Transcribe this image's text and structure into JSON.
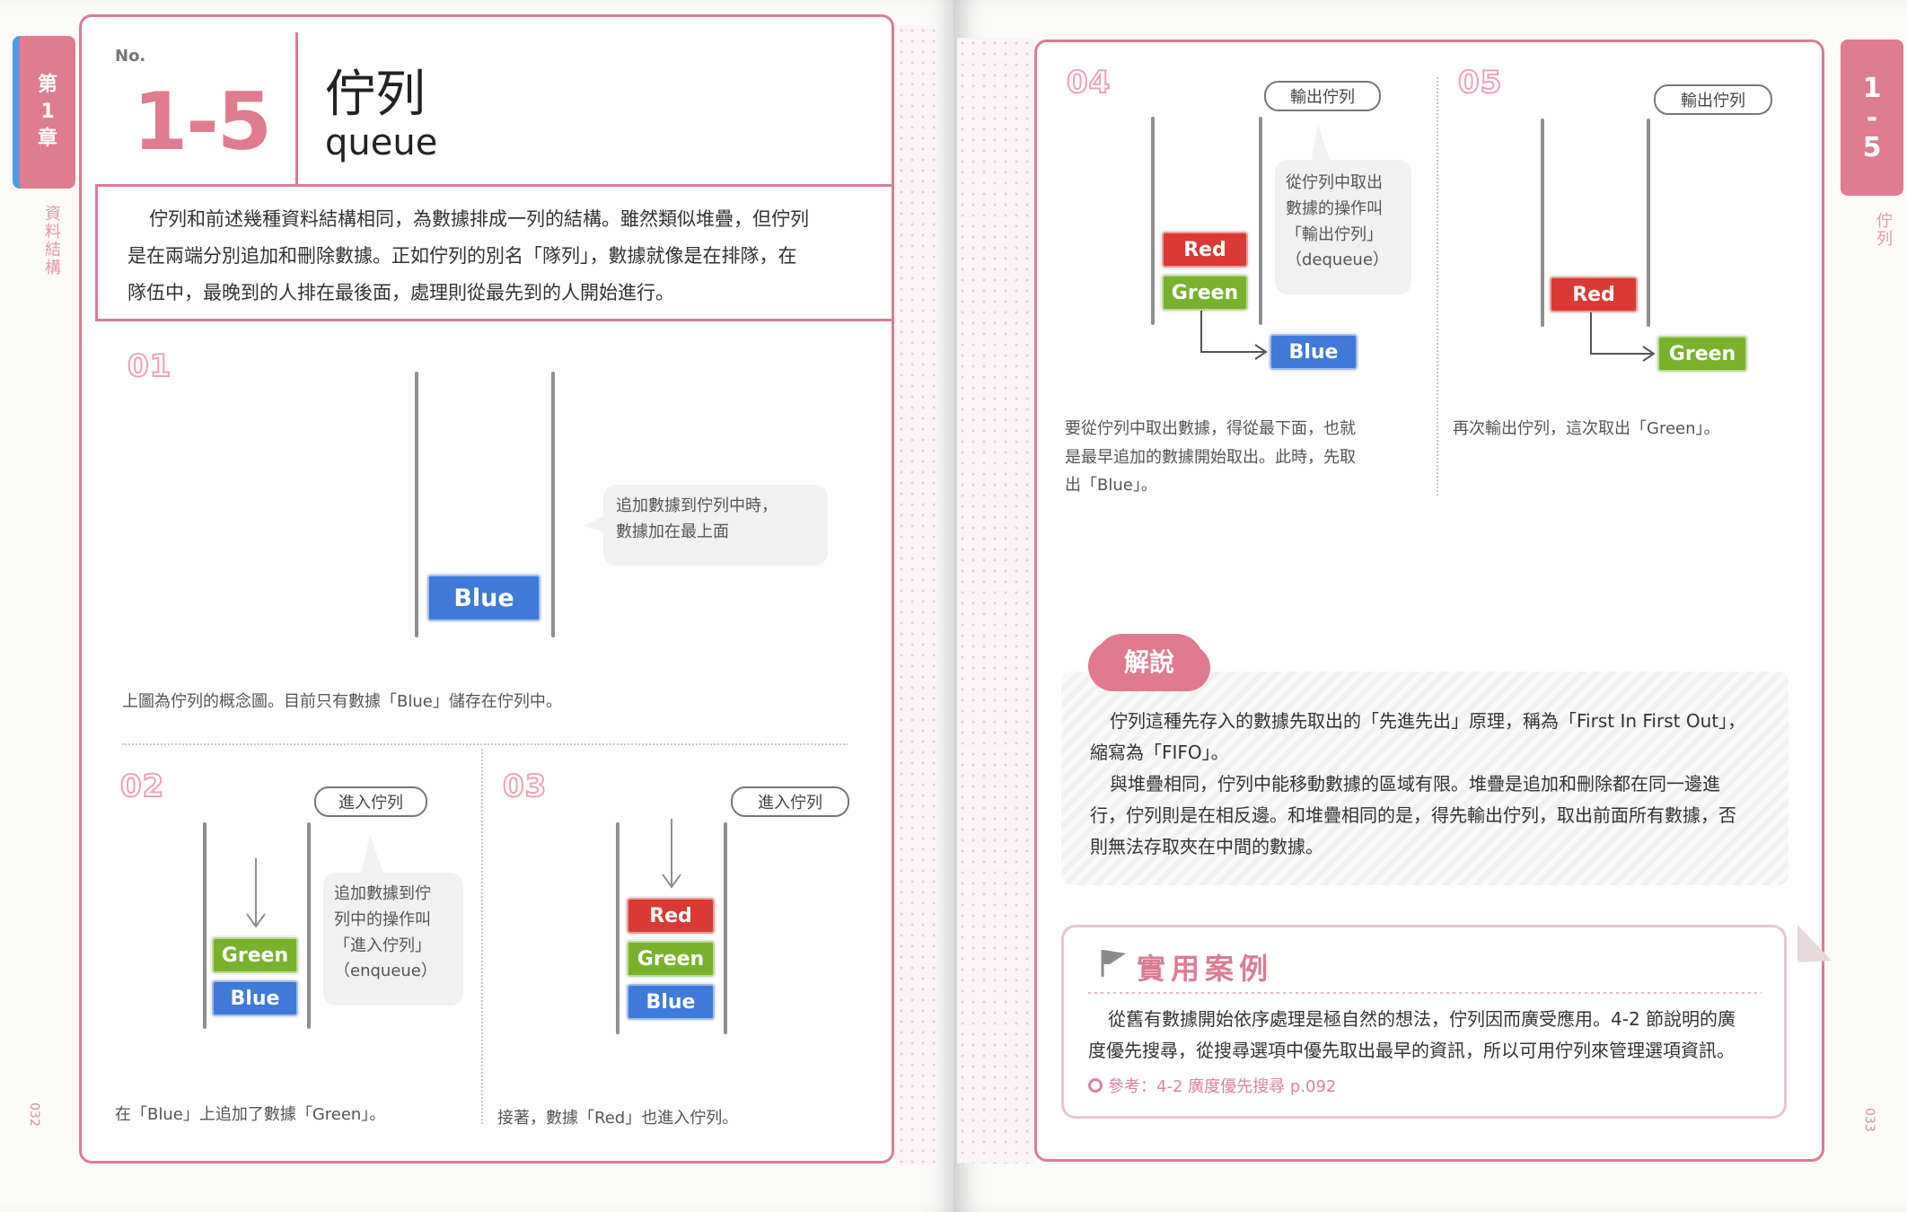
{
  "left_page": {
    "chapter_tab": {
      "line1": "第",
      "line2": "1",
      "line3": "章"
    },
    "side_label": "資料結構",
    "page_number": "032",
    "header": {
      "no_label": "No.",
      "number": "1-5",
      "title_zh": "佇列",
      "title_en": "queue"
    },
    "intro": {
      "line1": "佇列和前述幾種資料結構相同，為數據排成一列的結構。雖然類似堆疊，但佇列",
      "line2": "是在兩端分別追加和刪除數據。正如佇列的別名「隊列」，數據就像是在排隊，在",
      "line3": "隊伍中，最晚到的人排在最後面，處理則從最先到的人開始進行。"
    },
    "step01": {
      "num": "01",
      "block": "Blue",
      "bubble": {
        "line1": "追加數據到佇列中時，",
        "line2": "數據加在最上面"
      },
      "caption": "上圖為佇列的概念圖。目前只有數據「Blue」儲存在佇列中。"
    },
    "step02": {
      "num": "02",
      "pill": "進入佇列",
      "blocks": [
        "Green",
        "Blue"
      ],
      "bubble": {
        "line1": "追加數據到佇",
        "line2": "列中的操作叫",
        "line3": "「進入佇列」",
        "line4": "（enqueue）"
      },
      "caption": "在「Blue」上追加了數據「Green」。"
    },
    "step03": {
      "num": "03",
      "pill": "進入佇列",
      "blocks": [
        "Red",
        "Green",
        "Blue"
      ],
      "caption": "接著，數據「Red」也進入佇列。"
    }
  },
  "right_page": {
    "chapter_tab": {
      "line1": "1",
      "line2": "-",
      "line3": "5"
    },
    "side_label": "佇列",
    "page_number": "033",
    "step04": {
      "num": "04",
      "pill": "輸出佇列",
      "blocks": [
        "Red",
        "Green"
      ],
      "out_block": "Blue",
      "bubble": {
        "line1": "從佇列中取出",
        "line2": "數據的操作叫",
        "line3": "「輸出佇列」",
        "line4": "（dequeue）"
      },
      "caption": {
        "line1": "要從佇列中取出數據，得從最下面，也就",
        "line2": "是最早追加的數據開始取出。此時，先取",
        "line3": "出「Blue」。"
      }
    },
    "step05": {
      "num": "05",
      "pill": "輸出佇列",
      "blocks": [
        "Red"
      ],
      "out_block": "Green",
      "caption": "再次輸出佇列，這次取出「Green」。"
    },
    "explanation": {
      "badge": "解說",
      "line1": "佇列這種先存入的數據先取出的「先進先出」原理，稱為「First In First Out」，",
      "line2": "縮寫為「FIFO」。",
      "line3": "與堆疊相同，佇列中能移動數據的區域有限。堆疊是追加和刪除都在同一邊進",
      "line4": "行，佇列則是在相反邊。和堆疊相同的是，得先輸出佇列，取出前面所有數據，否",
      "line5": "則無法存取夾在中間的數據。"
    },
    "use_case": {
      "title": "實用案例",
      "line1": "從舊有數據開始依序處理是極自然的想法，佇列因而廣受應用。4-2 節說明的廣",
      "line2": "度優先搜尋，從搜尋選項中優先取出最早的資訊，所以可用佇列來管理選項資訊。",
      "reference": "參考：4-2  廣度優先搜尋  p.092"
    }
  },
  "colors": {
    "accent_pink": "#d97e92",
    "blue": "#3f79d9",
    "green": "#78b22c",
    "red": "#d93a33"
  }
}
